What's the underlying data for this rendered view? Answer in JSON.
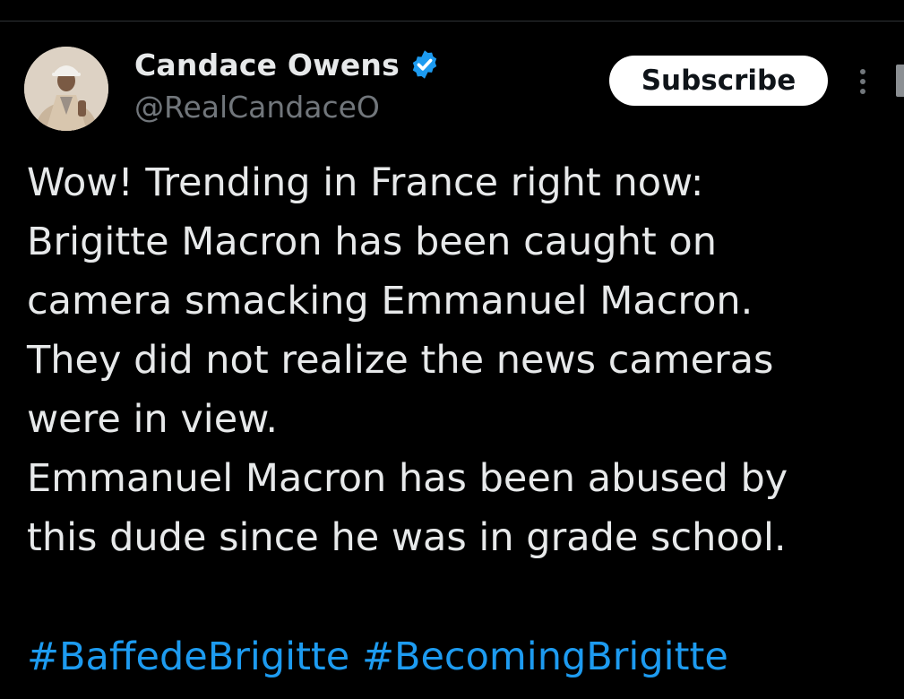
{
  "author": {
    "display_name": "Candace Owens",
    "handle": "@RealCandaceO",
    "verified": true,
    "avatar_icon": "profile-photo"
  },
  "actions": {
    "subscribe_label": "Subscribe",
    "more_icon": "vertical-ellipsis-icon"
  },
  "tweet": {
    "lines": [
      "Wow! Trending in France right now:",
      "Brigitte Macron has been caught on",
      "camera smacking Emmanuel Macron.",
      "They did not realize the news cameras",
      "were in view.",
      "Emmanuel Macron has been abused by",
      "this dude since he was in grade school."
    ],
    "hashtags": [
      "#BaffedeBrigitte",
      "#BecomingBrigitte"
    ]
  },
  "colors": {
    "background": "#000000",
    "text_primary": "#e7e9ea",
    "text_secondary": "#71767b",
    "link": "#1d9bf0",
    "verified_badge": "#1d9bf0",
    "button_bg": "#ffffff"
  }
}
